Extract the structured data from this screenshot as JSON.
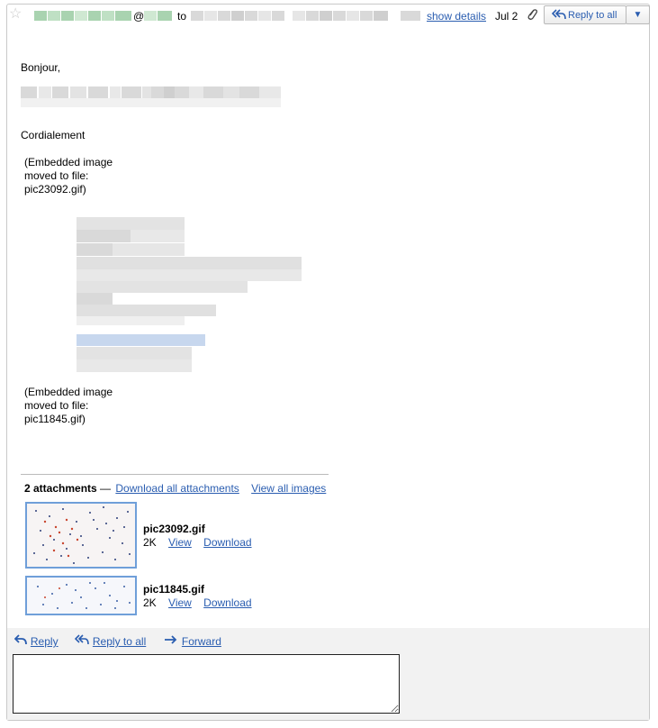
{
  "header": {
    "at_sign": "@",
    "to_label": "to",
    "show_details": "show details",
    "date": "Jul 2",
    "reply_to_all_button": "Reply to all",
    "dropdown_arrow": "▼"
  },
  "message": {
    "greeting": "Bonjour,",
    "closing": "Cordialement",
    "embedded_1": "(Embedded image moved to file: pic23092.gif)",
    "embedded_2": "(Embedded image moved to file: pic11845.gif)"
  },
  "attachments": {
    "count_label": "2 attachments",
    "separator": "—",
    "download_all": "Download all attachments",
    "view_all_images": "View all images",
    "items": [
      {
        "name": "pic23092.gif",
        "size": "2K",
        "view": "View",
        "download": "Download"
      },
      {
        "name": "pic11845.gif",
        "size": "2K",
        "view": "View",
        "download": "Download"
      }
    ]
  },
  "footer": {
    "reply": "Reply",
    "reply_to_all": "Reply to all",
    "forward": "Forward"
  },
  "colors": {
    "link": "#2a5db0",
    "thumb_border": "#6f9fd9",
    "footer_bg": "#f2f2f2"
  },
  "icons": [
    "star-icon",
    "paperclip-icon",
    "reply-all-icon",
    "chevron-down-icon",
    "reply-icon",
    "forward-icon"
  ]
}
